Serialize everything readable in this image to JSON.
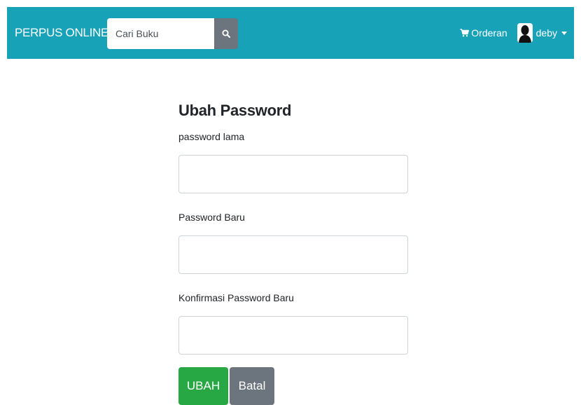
{
  "navbar": {
    "brand": "PERPUS ONLINE",
    "search": {
      "placeholder": "Cari Buku",
      "value": ""
    },
    "orderan_label": "Orderan",
    "user_name": "deby",
    "bg_color": "#17a2b8"
  },
  "form": {
    "title": "Ubah Password",
    "fields": [
      {
        "label": "password lama",
        "value": ""
      },
      {
        "label": "Password Baru",
        "value": ""
      },
      {
        "label": "Konfirmasi Password Baru",
        "value": ""
      }
    ],
    "submit_label": "UBAH",
    "cancel_label": "Batal",
    "submit_color": "#28a745",
    "cancel_color": "#6c757d"
  },
  "icons": {
    "search": "search-icon",
    "cart": "cart-icon",
    "avatar": "user-avatar-icon",
    "dropdown": "caret-down-icon"
  }
}
